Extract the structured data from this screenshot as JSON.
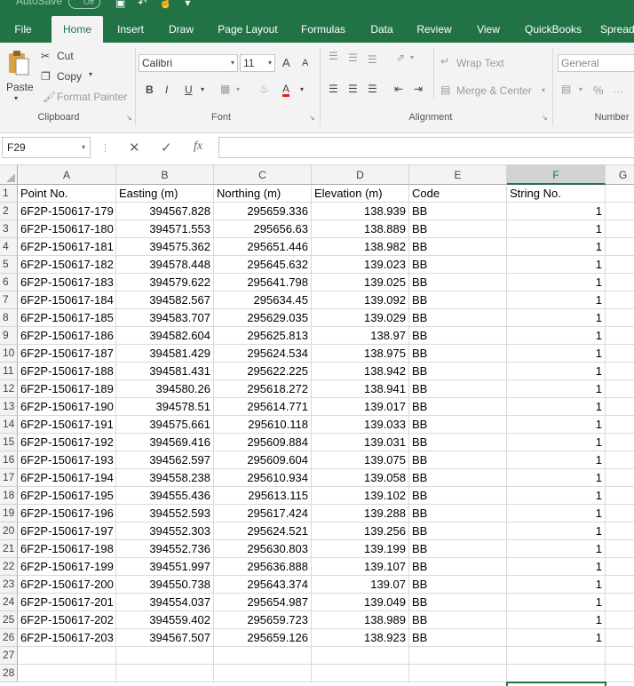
{
  "app": {
    "autosave_label": "AutoSave",
    "autosave_state": "Off",
    "accent_color": "#217346"
  },
  "tabs": [
    {
      "label": "File",
      "active": false
    },
    {
      "label": "Home",
      "active": true
    },
    {
      "label": "Insert",
      "active": false
    },
    {
      "label": "Draw",
      "active": false
    },
    {
      "label": "Page Layout",
      "active": false
    },
    {
      "label": "Formulas",
      "active": false
    },
    {
      "label": "Data",
      "active": false
    },
    {
      "label": "Review",
      "active": false
    },
    {
      "label": "View",
      "active": false
    },
    {
      "label": "QuickBooks",
      "active": false
    },
    {
      "label": "Spreadsh",
      "active": false
    }
  ],
  "ribbon": {
    "clipboard": {
      "paste": "Paste",
      "cut": "Cut",
      "copy": "Copy",
      "format_painter": "Format Painter",
      "group_label": "Clipboard"
    },
    "font": {
      "font_name": "Calibri",
      "font_size": "11",
      "bold": "B",
      "italic": "I",
      "underline": "U",
      "grow": "A",
      "shrink": "A",
      "font_color_letter": "A",
      "group_label": "Font"
    },
    "alignment": {
      "wrap_text": "Wrap Text",
      "merge_center": "Merge & Center",
      "group_label": "Alignment"
    },
    "number": {
      "format": "General",
      "percent": "%",
      "group_label": "Number"
    }
  },
  "formula_bar": {
    "name_box": "F29",
    "fx": "fx",
    "formula": ""
  },
  "sheet": {
    "columns": [
      "A",
      "B",
      "C",
      "D",
      "E",
      "F",
      "G"
    ],
    "selected_column": "F",
    "header_row": [
      "Point No.",
      "Easting (m)",
      "Northing (m)",
      "Elevation (m)",
      "Code",
      "String No."
    ],
    "data_rows": [
      [
        "6F2P-150617-179",
        "394567.828",
        "295659.336",
        "138.939",
        "BB",
        "1"
      ],
      [
        "6F2P-150617-180",
        "394571.553",
        "295656.63",
        "138.889",
        "BB",
        "1"
      ],
      [
        "6F2P-150617-181",
        "394575.362",
        "295651.446",
        "138.982",
        "BB",
        "1"
      ],
      [
        "6F2P-150617-182",
        "394578.448",
        "295645.632",
        "139.023",
        "BB",
        "1"
      ],
      [
        "6F2P-150617-183",
        "394579.622",
        "295641.798",
        "139.025",
        "BB",
        "1"
      ],
      [
        "6F2P-150617-184",
        "394582.567",
        "295634.45",
        "139.092",
        "BB",
        "1"
      ],
      [
        "6F2P-150617-185",
        "394583.707",
        "295629.035",
        "139.029",
        "BB",
        "1"
      ],
      [
        "6F2P-150617-186",
        "394582.604",
        "295625.813",
        "138.97",
        "BB",
        "1"
      ],
      [
        "6F2P-150617-187",
        "394581.429",
        "295624.534",
        "138.975",
        "BB",
        "1"
      ],
      [
        "6F2P-150617-188",
        "394581.431",
        "295622.225",
        "138.942",
        "BB",
        "1"
      ],
      [
        "6F2P-150617-189",
        "394580.26",
        "295618.272",
        "138.941",
        "BB",
        "1"
      ],
      [
        "6F2P-150617-190",
        "394578.51",
        "295614.771",
        "139.017",
        "BB",
        "1"
      ],
      [
        "6F2P-150617-191",
        "394575.661",
        "295610.118",
        "139.033",
        "BB",
        "1"
      ],
      [
        "6F2P-150617-192",
        "394569.416",
        "295609.884",
        "139.031",
        "BB",
        "1"
      ],
      [
        "6F2P-150617-193",
        "394562.597",
        "295609.604",
        "139.075",
        "BB",
        "1"
      ],
      [
        "6F2P-150617-194",
        "394558.238",
        "295610.934",
        "139.058",
        "BB",
        "1"
      ],
      [
        "6F2P-150617-195",
        "394555.436",
        "295613.115",
        "139.102",
        "BB",
        "1"
      ],
      [
        "6F2P-150617-196",
        "394552.593",
        "295617.424",
        "139.288",
        "BB",
        "1"
      ],
      [
        "6F2P-150617-197",
        "394552.303",
        "295624.521",
        "139.256",
        "BB",
        "1"
      ],
      [
        "6F2P-150617-198",
        "394552.736",
        "295630.803",
        "139.199",
        "BB",
        "1"
      ],
      [
        "6F2P-150617-199",
        "394551.997",
        "295636.888",
        "139.107",
        "BB",
        "1"
      ],
      [
        "6F2P-150617-200",
        "394550.738",
        "295643.374",
        "139.07",
        "BB",
        "1"
      ],
      [
        "6F2P-150617-201",
        "394554.037",
        "295654.987",
        "139.049",
        "BB",
        "1"
      ],
      [
        "6F2P-150617-202",
        "394559.402",
        "295659.723",
        "138.989",
        "BB",
        "1"
      ],
      [
        "6F2P-150617-203",
        "394567.507",
        "295659.126",
        "138.923",
        "BB",
        "1"
      ]
    ],
    "empty_row_numbers": [
      "27",
      "28"
    ]
  }
}
